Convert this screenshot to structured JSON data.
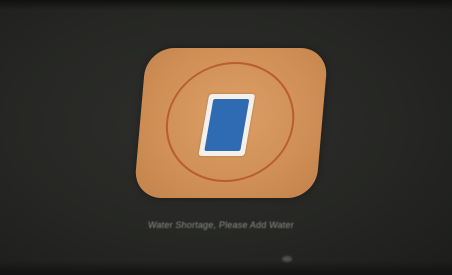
{
  "alert": {
    "icon": "water-tank-icon",
    "message": "Water Shortage, Please Add Water"
  },
  "colors": {
    "card": "#d3955a",
    "ring": "#b4552c",
    "tank_frame": "#f4efe8",
    "tank_fill": "#2f6bb3",
    "screen_bg": "#262724",
    "message_text": "#8c8c88"
  }
}
